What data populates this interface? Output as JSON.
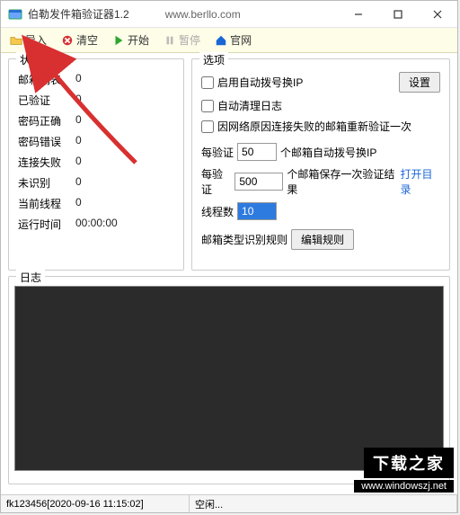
{
  "window": {
    "title": "伯勒发件箱验证器1.2",
    "url": "www.berllo.com"
  },
  "toolbar": {
    "import_label": "导入",
    "clear_label": "清空",
    "start_label": "开始",
    "pause_label": "暂停",
    "site_label": "官网"
  },
  "status": {
    "panel_title": "状态",
    "rows": [
      {
        "label": "邮箱列表",
        "value": "0"
      },
      {
        "label": "已验证",
        "value": "0"
      },
      {
        "label": "密码正确",
        "value": "0"
      },
      {
        "label": "密码错误",
        "value": "0"
      },
      {
        "label": "连接失败",
        "value": "0"
      },
      {
        "label": "未识别",
        "value": "0"
      },
      {
        "label": "当前线程",
        "value": "0"
      },
      {
        "label": "运行时间",
        "value": "00:00:00"
      }
    ]
  },
  "options": {
    "panel_title": "选项",
    "cb_autodial": "启用自动拨号换IP",
    "btn_settings": "设置",
    "cb_autoclean": "自动清理日志",
    "cb_retry": "因网络原因连接失败的邮箱重新验证一次",
    "verify_prefix": "每验证",
    "dial_count": "50",
    "dial_suffix": "个邮箱自动拨号换IP",
    "save_count": "500",
    "save_suffix": "个邮箱保存一次验证结果",
    "open_dir": "打开目录",
    "threads_label": "线程数",
    "threads_value": "10",
    "rule_label": "邮箱类型识别规则",
    "btn_editrule": "编辑规则"
  },
  "log": {
    "panel_title": "日志"
  },
  "statusbar": {
    "left": "fk123456[2020-09-16 11:15:02]",
    "right": "空闲..."
  },
  "watermark": {
    "top": "下载之家",
    "bottom": "www.windowszj.net"
  },
  "colors": {
    "toolbar_bg": "#fdfde8",
    "log_bg": "#2b2b2b",
    "arrow": "#d83030",
    "link": "#1a66d6",
    "start_green": "#2fa62f",
    "clear_red": "#d83030",
    "site_blue": "#1a66d6"
  }
}
